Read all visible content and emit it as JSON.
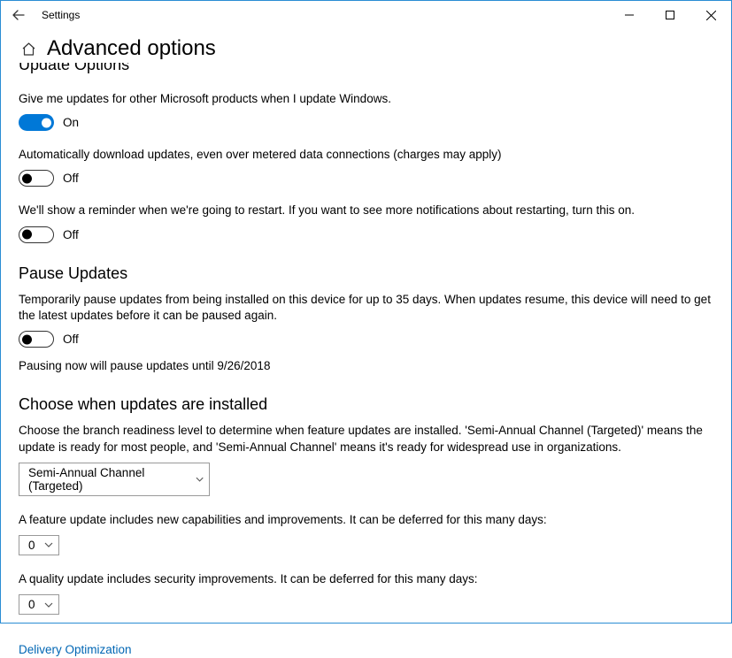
{
  "titlebar": {
    "app_title": "Settings"
  },
  "header": {
    "page_title": "Advanced options"
  },
  "cut_heading": "Update Options",
  "update_options": {
    "microsoft_products": {
      "desc": "Give me updates for other Microsoft products when I update Windows.",
      "label": "On"
    },
    "metered": {
      "desc": "Automatically download updates, even over metered data connections (charges may apply)",
      "label": "Off"
    },
    "restart_reminder": {
      "desc": "We'll show a reminder when we're going to restart. If you want to see more notifications about restarting, turn this on.",
      "label": "Off"
    }
  },
  "pause": {
    "heading": "Pause Updates",
    "desc": "Temporarily pause updates from being installed on this device for up to 35 days. When updates resume, this device will need to get the latest updates before it can be paused again.",
    "label": "Off",
    "note": "Pausing now will pause updates until 9/26/2018"
  },
  "choose": {
    "heading": "Choose when updates are installed",
    "desc": "Choose the branch readiness level to determine when feature updates are installed. 'Semi-Annual Channel (Targeted)' means the update is ready for most people, and 'Semi-Annual Channel' means it's ready for widespread use in organizations.",
    "branch_value": "Semi-Annual Channel (Targeted)",
    "feature_desc": "A feature update includes new capabilities and improvements. It can be deferred for this many days:",
    "feature_value": "0",
    "quality_desc": "A quality update includes security improvements. It can be deferred for this many days:",
    "quality_value": "0"
  },
  "link": {
    "delivery": "Delivery Optimization"
  }
}
